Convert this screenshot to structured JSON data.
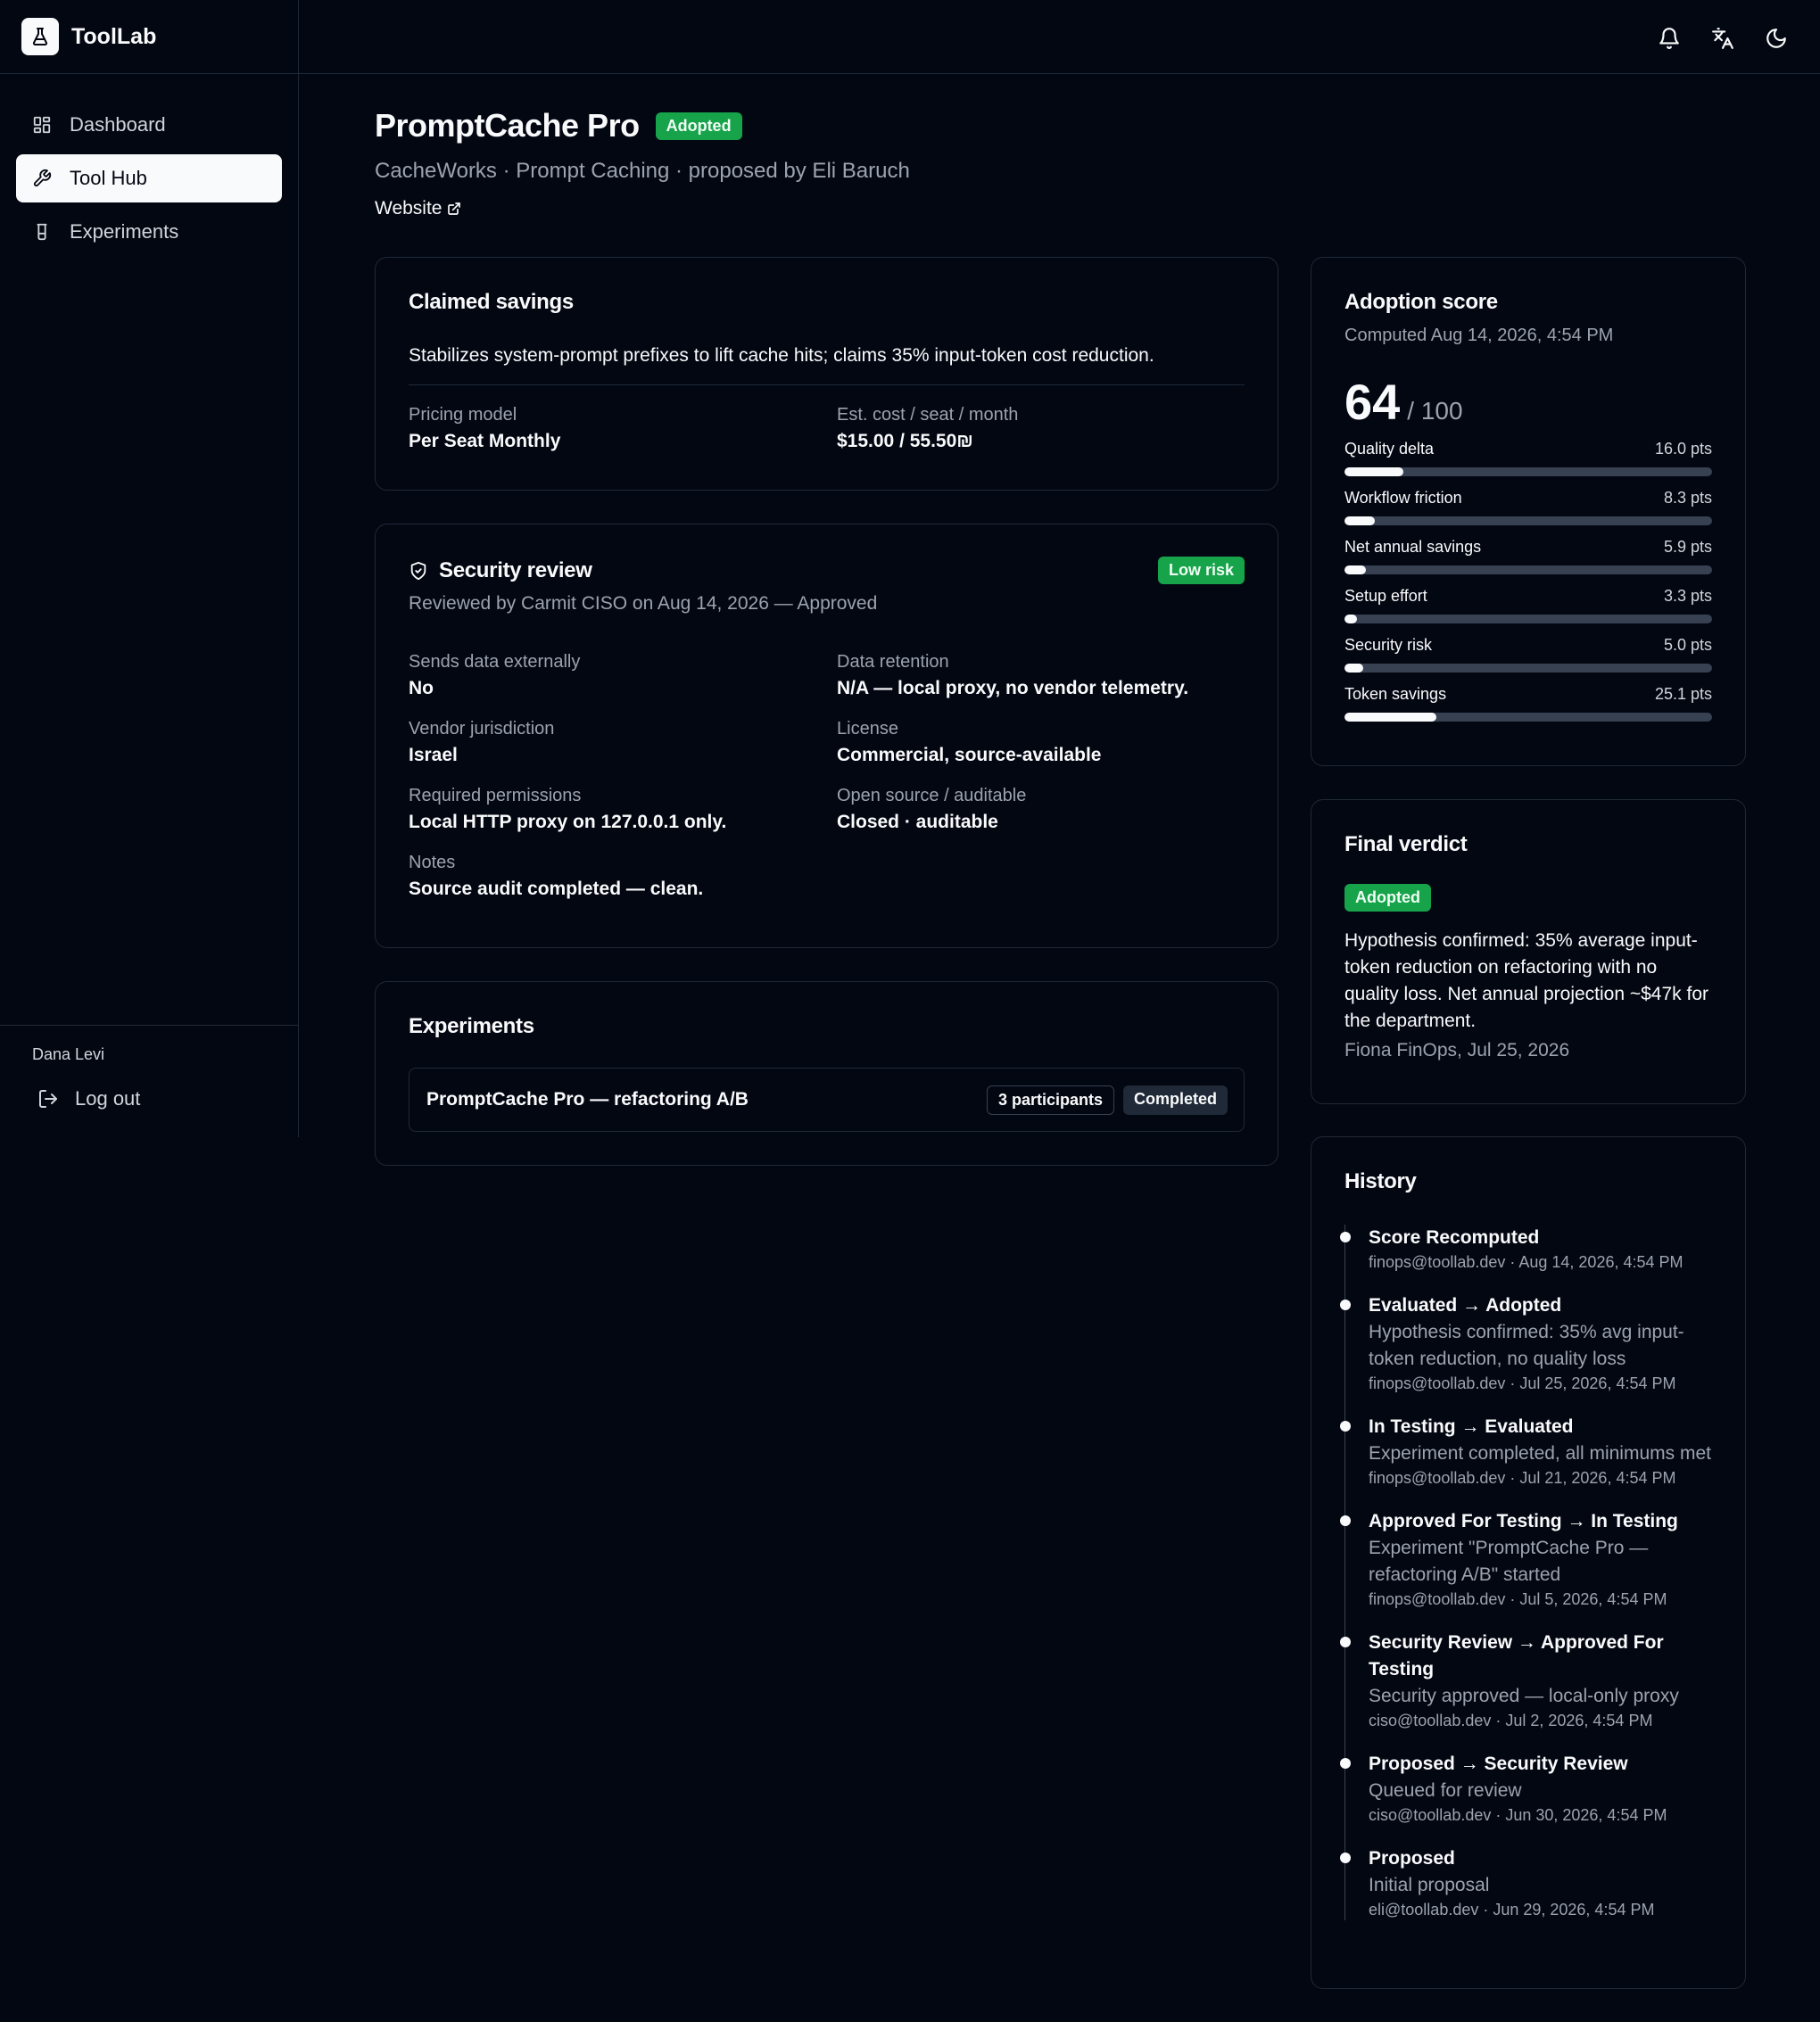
{
  "app": {
    "name": "ToolLab"
  },
  "nav": {
    "items": [
      {
        "label": "Dashboard",
        "icon": "dashboard-icon"
      },
      {
        "label": "Tool Hub",
        "icon": "wrench-icon",
        "active": true
      },
      {
        "label": "Experiments",
        "icon": "flask-icon"
      }
    ]
  },
  "user": {
    "name": "Dana Levi",
    "logout_label": "Log out"
  },
  "header": {
    "title": "PromptCache Pro",
    "status": "Adopted",
    "subtitle": "CacheWorks · Prompt Caching · proposed by Eli Baruch",
    "website_label": "Website"
  },
  "claimed": {
    "title": "Claimed savings",
    "description": "Stabilizes system-prompt prefixes to lift cache hits; claims 35% input-token cost reduction.",
    "pricing_label": "Pricing model",
    "pricing_value": "Per Seat Monthly",
    "cost_label": "Est. cost / seat / month",
    "cost_value": "$15.00 /  55.50₪"
  },
  "security": {
    "title": "Security review",
    "risk": "Low risk",
    "reviewed": "Reviewed by Carmit CISO on Aug 14, 2026 — Approved",
    "fields": [
      {
        "label": "Sends data externally",
        "value": "No"
      },
      {
        "label": "Data retention",
        "value": "N/A — local proxy, no vendor telemetry."
      },
      {
        "label": "Vendor jurisdiction",
        "value": "Israel"
      },
      {
        "label": "License",
        "value": "Commercial, source-available"
      },
      {
        "label": "Required permissions",
        "value": "Local HTTP proxy on 127.0.0.1 only."
      },
      {
        "label": "Open source / auditable",
        "value": "Closed · auditable"
      },
      {
        "label": "Notes",
        "value": "Source audit completed — clean."
      }
    ]
  },
  "experiments": {
    "title": "Experiments",
    "items": [
      {
        "name": "PromptCache Pro — refactoring A/B",
        "participants": "3 participants",
        "status": "Completed"
      }
    ]
  },
  "score": {
    "title": "Adoption score",
    "computed": "Computed Aug 14, 2026, 4:54 PM",
    "value": "64",
    "max": "/ 100",
    "metrics": [
      {
        "label": "Quality delta",
        "pts": "16.0 pts",
        "fraction": 0.16
      },
      {
        "label": "Workflow friction",
        "pts": "8.3 pts",
        "fraction": 0.083
      },
      {
        "label": "Net annual savings",
        "pts": "5.9 pts",
        "fraction": 0.059
      },
      {
        "label": "Setup effort",
        "pts": "3.3 pts",
        "fraction": 0.033
      },
      {
        "label": "Security risk",
        "pts": "5.0 pts",
        "fraction": 0.05
      },
      {
        "label": "Token savings",
        "pts": "25.1 pts",
        "fraction": 0.251
      }
    ]
  },
  "verdict": {
    "title": "Final verdict",
    "status": "Adopted",
    "text": "Hypothesis confirmed: 35% average input-token reduction on refactoring with no quality loss. Net annual projection ~$47k for the department.",
    "by": "Fiona FinOps, Jul 25, 2026"
  },
  "history": {
    "title": "History",
    "items": [
      {
        "title": "Score Recomputed",
        "desc": "",
        "meta": "finops@toollab.dev · Aug 14, 2026, 4:54 PM"
      },
      {
        "title": "Evaluated → Adopted",
        "desc": "Hypothesis confirmed: 35% avg input-token reduction, no quality loss",
        "meta": "finops@toollab.dev · Jul 25, 2026, 4:54 PM"
      },
      {
        "title": "In Testing → Evaluated",
        "desc": "Experiment completed, all minimums met",
        "meta": "finops@toollab.dev · Jul 21, 2026, 4:54 PM"
      },
      {
        "title": "Approved For Testing → In Testing",
        "desc": "Experiment \"PromptCache Pro — refactoring A/B\" started",
        "meta": "finops@toollab.dev · Jul 5, 2026, 4:54 PM"
      },
      {
        "title": "Security Review → Approved For Testing",
        "desc": "Security approved — local-only proxy",
        "meta": "ciso@toollab.dev · Jul 2, 2026, 4:54 PM"
      },
      {
        "title": "Proposed → Security Review",
        "desc": "Queued for review",
        "meta": "ciso@toollab.dev · Jun 30, 2026, 4:54 PM"
      },
      {
        "title": "Proposed",
        "desc": "Initial proposal",
        "meta": "eli@toollab.dev · Jun 29, 2026, 4:54 PM"
      }
    ]
  },
  "colors": {
    "background": "#030712",
    "accent_green": "#16a34a",
    "border": "#1f2937"
  }
}
